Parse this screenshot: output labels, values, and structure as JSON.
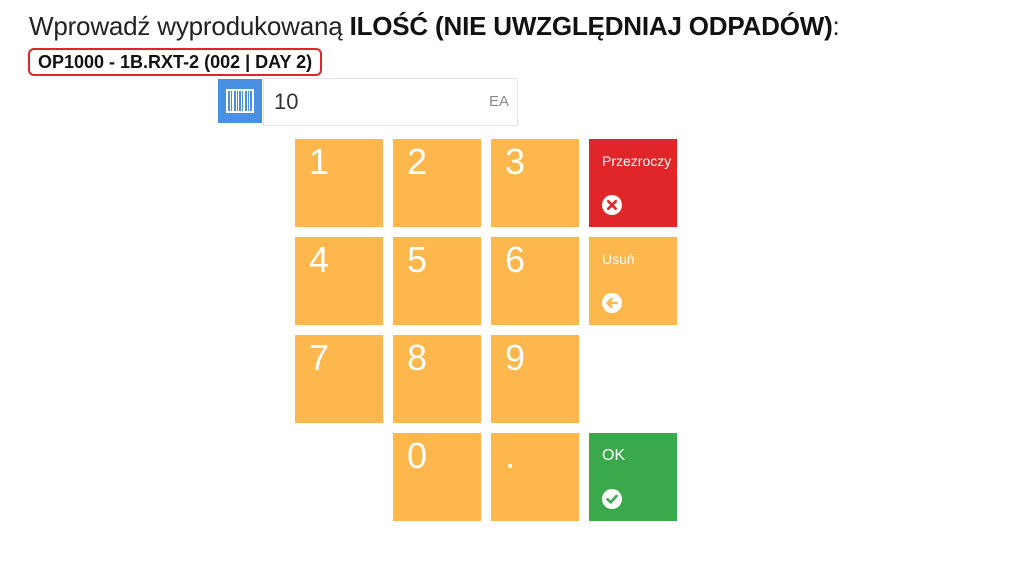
{
  "header": {
    "prefix": "Wprowadź wyprodukowaną ",
    "emphasis": "ILOŚĆ (NIE UWZGLĘDNIAJ ODPADÓW)",
    "suffix": ":"
  },
  "operation_badge": "OP1000 - 1B.RXT-2 (002 | DAY 2)",
  "quantity": {
    "value": "10",
    "unit": "EA"
  },
  "keypad": {
    "keys": [
      "1",
      "2",
      "3",
      "4",
      "5",
      "6",
      "7",
      "8",
      "9",
      "0",
      "."
    ],
    "clear_label": "Przezroczy",
    "delete_label": "Usuń",
    "ok_label": "OK"
  },
  "colors": {
    "key_orange": "#fdb74d",
    "clear_red": "#e02628",
    "ok_green": "#3aa94b",
    "barcode_blue": "#4a90e2",
    "badge_border_red": "#e0262b"
  },
  "icons": {
    "barcode": "barcode-icon",
    "clear": "close-circle-icon",
    "delete": "arrow-left-circle-icon",
    "ok": "check-circle-icon"
  }
}
